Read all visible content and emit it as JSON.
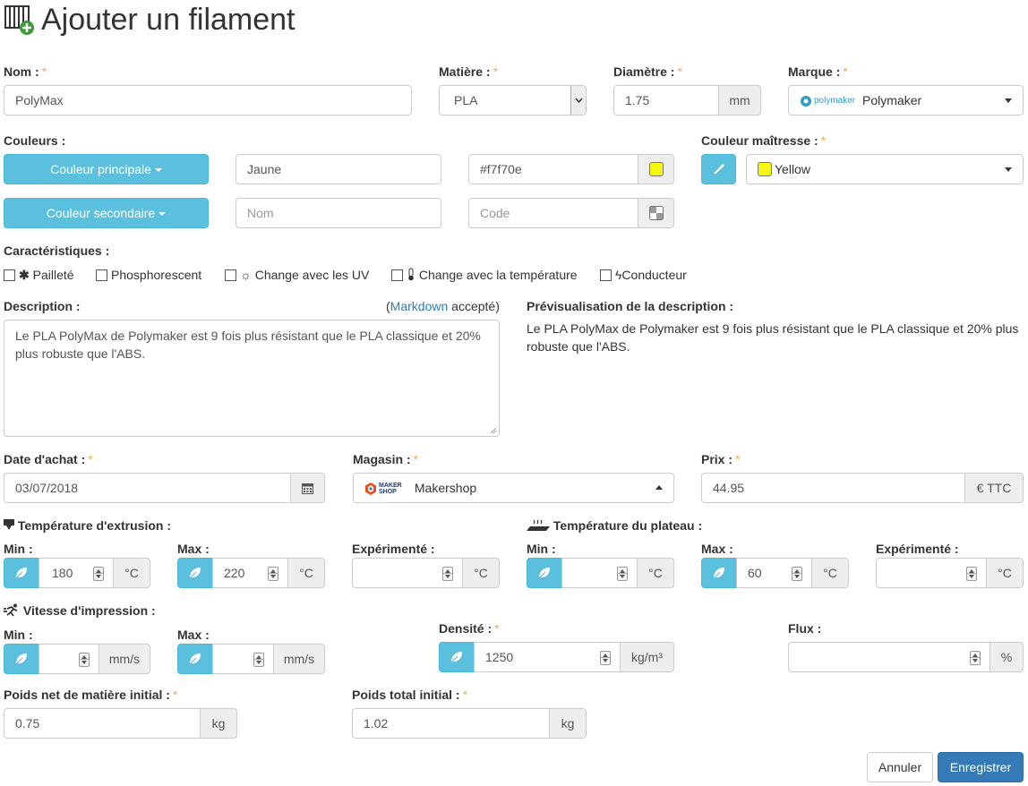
{
  "header": {
    "title": "Ajouter un filament",
    "icon": "add-filament-icon"
  },
  "required_mark": "*",
  "nom": {
    "label": "Nom :",
    "value": "PolyMax"
  },
  "matiere": {
    "label": "Matière :",
    "value": "PLA"
  },
  "diametre": {
    "label": "Diamètre :",
    "value": "1.75",
    "unit": "mm"
  },
  "marque": {
    "label": "Marque :",
    "logo_text": "polymaker",
    "value": "Polymaker"
  },
  "couleurs": {
    "label": "Couleurs :",
    "primary": {
      "button": "Couleur principale",
      "name": "Jaune",
      "code": "#f7f70e",
      "swatch": "#f7f70e"
    },
    "secondary": {
      "button": "Couleur secondaire",
      "name_placeholder": "Nom",
      "code_placeholder": "Code"
    }
  },
  "couleur_maitresse": {
    "label": "Couleur maîtresse :",
    "value": "Yellow",
    "swatch": "#f7f70e"
  },
  "caracteristiques": {
    "label": "Caractéristiques :",
    "items": [
      {
        "label": "Pailleté",
        "icon": "asterisk-icon"
      },
      {
        "label": "Phosphorescent",
        "icon": ""
      },
      {
        "label": "Change avec les UV",
        "icon": "sun-icon"
      },
      {
        "label": "Change avec la température",
        "icon": "thermometer-icon"
      },
      {
        "label": "Conducteur",
        "icon": "bolt-icon"
      }
    ]
  },
  "description": {
    "label": "Description :",
    "note_open": "(",
    "note_link": "Markdown",
    "note_close": " accepté)",
    "text": "Le PLA PolyMax de Polymaker est 9 fois plus résistant que le PLA classique et 20% plus robuste que l'ABS.",
    "preview_label": "Prévisualisation de la description :",
    "preview_text": "Le PLA PolyMax de Polymaker est 9 fois plus résistant que le PLA classique et 20% plus robuste que l'ABS."
  },
  "date_achat": {
    "label": "Date d'achat :",
    "value": "03/07/2018"
  },
  "magasin": {
    "label": "Magasin :",
    "logo_text": "MAKER SHOP",
    "value": "Makershop"
  },
  "prix": {
    "label": "Prix :",
    "value": "44.95",
    "unit": "€ TTC"
  },
  "extrusion": {
    "title": "Température d'extrusion :",
    "min": {
      "label": "Min :",
      "value": "180",
      "unit": "°C"
    },
    "max": {
      "label": "Max :",
      "value": "220",
      "unit": "°C"
    },
    "exp": {
      "label": "Expérimenté :",
      "value": "",
      "unit": "°C"
    }
  },
  "plateau": {
    "title": "Température du plateau :",
    "min": {
      "label": "Min :",
      "value": "",
      "unit": "°C"
    },
    "max": {
      "label": "Max :",
      "value": "60",
      "unit": "°C"
    },
    "exp": {
      "label": "Expérimenté :",
      "value": "",
      "unit": "°C"
    }
  },
  "vitesse": {
    "title": "Vitesse d'impression :",
    "min": {
      "label": "Min :",
      "value": "",
      "unit": "mm/s"
    },
    "max": {
      "label": "Max :",
      "value": "",
      "unit": "mm/s"
    }
  },
  "densite": {
    "label": "Densité :",
    "value": "1250",
    "unit": "kg/m³"
  },
  "flux": {
    "label": "Flux :",
    "value": "",
    "unit": "%"
  },
  "poids_net": {
    "label": "Poids net de matière initial :",
    "value": "0.75",
    "unit": "kg"
  },
  "poids_total": {
    "label": "Poids total initial :",
    "value": "1.02",
    "unit": "kg"
  },
  "actions": {
    "cancel": "Annuler",
    "save": "Enregistrer"
  },
  "colors": {
    "info": "#5bc0de",
    "primary": "#337ab7",
    "required": "#f0ad4e"
  }
}
